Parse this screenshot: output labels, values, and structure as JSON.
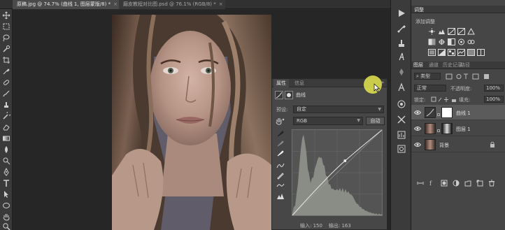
{
  "document_tabs": [
    {
      "label": "原稿.jpg @ 74.7% (曲线 1, 图层蒙版/8) *",
      "active": true
    },
    {
      "label": "磨皮教程对比图.psd @ 76.1% (RGB/8) *",
      "active": false
    }
  ],
  "close_glyph": "×",
  "properties_panel": {
    "tabs": [
      "属性",
      "信息"
    ],
    "collapse_glyph": "»",
    "adjustment_title": "曲线",
    "preset_label": "预设:",
    "preset_value": "自定",
    "channel_value": "RGB",
    "auto_label": "自动",
    "input_label": "输入:",
    "input_value": "150",
    "output_label": "输出:",
    "output_value": "163",
    "curve_point": {
      "input": 150,
      "output": 163
    },
    "histogram_color": "#8a8d86"
  },
  "adjustments_panel": {
    "title": "调整",
    "subtitle": "添加调整",
    "icons": [
      "brightness-icon",
      "levels-icon",
      "curves-icon",
      "exposure-icon",
      "vibrance-icon",
      "hue-saturation-icon",
      "color-balance-icon",
      "black-white-icon",
      "photo-filter-icon",
      "channel-mixer-icon",
      "color-lookup-icon",
      "invert-icon",
      "posterize-icon",
      "threshold-icon",
      "gradient-map-icon",
      "selective-color-icon"
    ]
  },
  "layers_panel": {
    "tabs": [
      "图层",
      "通道",
      "历史记录",
      "路径"
    ],
    "filter_kind": "类型",
    "blend_mode": "正常",
    "opacity_label": "不透明度:",
    "opacity_value": "100%",
    "lock_label": "锁定:",
    "fill_label": "填充:",
    "fill_value": "100%",
    "layers": [
      {
        "name": "曲线 1",
        "selected": true
      },
      {
        "name": "图层 1",
        "selected": false
      },
      {
        "name": "背景",
        "selected": false
      }
    ]
  },
  "colors": {
    "accent_cursor": "#e6e650",
    "photo_bg": "#5c5a65"
  }
}
